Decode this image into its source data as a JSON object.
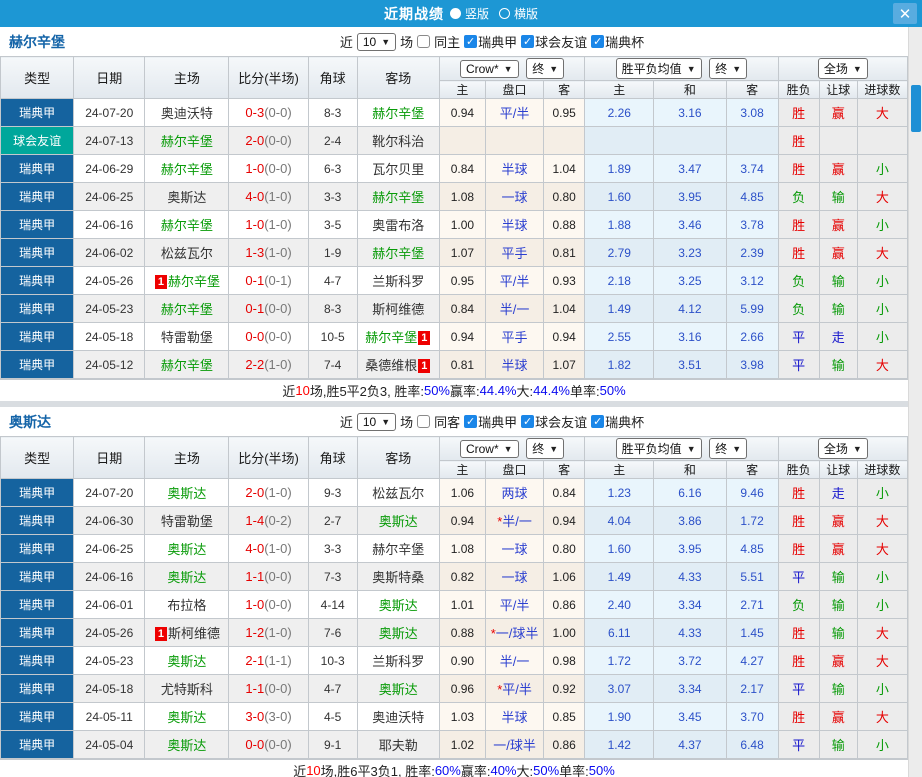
{
  "titlebar": {
    "title": "近期战绩",
    "radio_vertical": "竖版",
    "radio_horizontal": "横版",
    "close": "✕"
  },
  "accent_colors": {
    "titlebar_blue": "#1d97d4",
    "league_blue": "#15639f",
    "friendly_teal": "#00a79b",
    "win_red": "#e60000",
    "lose_green": "#089b08",
    "draw_blue": "#1414cc"
  },
  "filter": {
    "near": "近",
    "count": "10",
    "games": "场"
  },
  "table_header": {
    "type": "类型",
    "date": "日期",
    "home": "主场",
    "score": "比分(半场)",
    "corner": "角球",
    "away": "客场",
    "dd_crow": "Crow*",
    "dd_final1": "终",
    "dd_mean": "胜平负均值",
    "dd_final2": "终",
    "dd_full": "全场",
    "sub_home": "主",
    "sub_handicap": "盘口",
    "sub_away": "客",
    "sub_mwin": "主",
    "sub_mdraw": "和",
    "sub_mlose": "客",
    "res_wdl": "胜负",
    "res_handicap": "让球",
    "res_goals": "进球数"
  },
  "sections": [
    {
      "team": "赫尔辛堡",
      "same_label": "同主",
      "leagues": [
        "瑞典甲",
        "球会友谊",
        "瑞典杯"
      ],
      "rows": [
        {
          "type": "瑞典甲",
          "date": "24-07-20",
          "home": "奥迪沃特",
          "home_focus": false,
          "home_badge": false,
          "score": "0-3",
          "half": "(0-0)",
          "corner": "8-3",
          "away": "赫尔辛堡",
          "away_focus": true,
          "away_badge": false,
          "odds": [
            "0.94",
            "平/半",
            "0.95"
          ],
          "star": false,
          "mean": [
            "2.26",
            "3.16",
            "3.08"
          ],
          "res": [
            "胜",
            "赢",
            "大"
          ]
        },
        {
          "type": "球会友谊",
          "date": "24-07-13",
          "home": "赫尔辛堡",
          "home_focus": true,
          "home_badge": false,
          "score": "2-0",
          "half": "(0-0)",
          "corner": "2-4",
          "away": "靴尔科治",
          "away_focus": false,
          "away_badge": false,
          "odds": [
            "",
            "",
            ""
          ],
          "star": false,
          "mean": [
            "",
            "",
            ""
          ],
          "res": [
            "胜",
            "",
            ""
          ]
        },
        {
          "type": "瑞典甲",
          "date": "24-06-29",
          "home": "赫尔辛堡",
          "home_focus": true,
          "home_badge": false,
          "score": "1-0",
          "half": "(0-0)",
          "corner": "6-3",
          "away": "瓦尔贝里",
          "away_focus": false,
          "away_badge": false,
          "odds": [
            "0.84",
            "半球",
            "1.04"
          ],
          "star": false,
          "mean": [
            "1.89",
            "3.47",
            "3.74"
          ],
          "res": [
            "胜",
            "赢",
            "小"
          ]
        },
        {
          "type": "瑞典甲",
          "date": "24-06-25",
          "home": "奥斯达",
          "home_focus": false,
          "home_badge": false,
          "score": "4-0",
          "half": "(1-0)",
          "corner": "3-3",
          "away": "赫尔辛堡",
          "away_focus": true,
          "away_badge": false,
          "odds": [
            "1.08",
            "一球",
            "0.80"
          ],
          "star": false,
          "mean": [
            "1.60",
            "3.95",
            "4.85"
          ],
          "res": [
            "负",
            "输",
            "大"
          ]
        },
        {
          "type": "瑞典甲",
          "date": "24-06-16",
          "home": "赫尔辛堡",
          "home_focus": true,
          "home_badge": false,
          "score": "1-0",
          "half": "(1-0)",
          "corner": "3-5",
          "away": "奥雷布洛",
          "away_focus": false,
          "away_badge": false,
          "odds": [
            "1.00",
            "半球",
            "0.88"
          ],
          "star": false,
          "mean": [
            "1.88",
            "3.46",
            "3.78"
          ],
          "res": [
            "胜",
            "赢",
            "小"
          ]
        },
        {
          "type": "瑞典甲",
          "date": "24-06-02",
          "home": "松兹瓦尔",
          "home_focus": false,
          "home_badge": false,
          "score": "1-3",
          "half": "(1-0)",
          "corner": "1-9",
          "away": "赫尔辛堡",
          "away_focus": true,
          "away_badge": false,
          "odds": [
            "1.07",
            "平手",
            "0.81"
          ],
          "star": false,
          "mean": [
            "2.79",
            "3.23",
            "2.39"
          ],
          "res": [
            "胜",
            "赢",
            "大"
          ]
        },
        {
          "type": "瑞典甲",
          "date": "24-05-26",
          "home": "赫尔辛堡",
          "home_focus": true,
          "home_badge": true,
          "score": "0-1",
          "half": "(0-1)",
          "corner": "4-7",
          "away": "兰斯科罗",
          "away_focus": false,
          "away_badge": false,
          "odds": [
            "0.95",
            "平/半",
            "0.93"
          ],
          "star": false,
          "mean": [
            "2.18",
            "3.25",
            "3.12"
          ],
          "res": [
            "负",
            "输",
            "小"
          ]
        },
        {
          "type": "瑞典甲",
          "date": "24-05-23",
          "home": "赫尔辛堡",
          "home_focus": true,
          "home_badge": false,
          "score": "0-1",
          "half": "(0-0)",
          "corner": "8-3",
          "away": "斯柯维德",
          "away_focus": false,
          "away_badge": false,
          "odds": [
            "0.84",
            "半/一",
            "1.04"
          ],
          "star": false,
          "mean": [
            "1.49",
            "4.12",
            "5.99"
          ],
          "res": [
            "负",
            "输",
            "小"
          ]
        },
        {
          "type": "瑞典甲",
          "date": "24-05-18",
          "home": "特雷勒堡",
          "home_focus": false,
          "home_badge": false,
          "score": "0-0",
          "half": "(0-0)",
          "corner": "10-5",
          "away": "赫尔辛堡",
          "away_focus": true,
          "away_badge": true,
          "odds": [
            "0.94",
            "平手",
            "0.94"
          ],
          "star": false,
          "mean": [
            "2.55",
            "3.16",
            "2.66"
          ],
          "res": [
            "平",
            "走",
            "小"
          ]
        },
        {
          "type": "瑞典甲",
          "date": "24-05-12",
          "home": "赫尔辛堡",
          "home_focus": true,
          "home_badge": false,
          "score": "2-2",
          "half": "(1-0)",
          "corner": "7-4",
          "away": "桑德维根",
          "away_focus": false,
          "away_badge": true,
          "odds": [
            "0.81",
            "半球",
            "1.07"
          ],
          "star": false,
          "mean": [
            "1.82",
            "3.51",
            "3.98"
          ],
          "res": [
            "平",
            "输",
            "大"
          ]
        }
      ],
      "summary": [
        {
          "t": "近",
          "c": "k"
        },
        {
          "t": "10",
          "c": "r"
        },
        {
          "t": "场,胜5平2负3, 胜率:",
          "c": "k"
        },
        {
          "t": "50%",
          "c": "b"
        },
        {
          "t": " 赢率:",
          "c": "k"
        },
        {
          "t": "44.4%",
          "c": "b"
        },
        {
          "t": " 大:",
          "c": "k"
        },
        {
          "t": "44.4%",
          "c": "b"
        },
        {
          "t": " 单率:",
          "c": "k"
        },
        {
          "t": "50%",
          "c": "b"
        }
      ]
    },
    {
      "team": "奥斯达",
      "same_label": "同客",
      "leagues": [
        "瑞典甲",
        "球会友谊",
        "瑞典杯"
      ],
      "rows": [
        {
          "type": "瑞典甲",
          "date": "24-07-20",
          "home": "奥斯达",
          "home_focus": true,
          "home_badge": false,
          "score": "2-0",
          "half": "(1-0)",
          "corner": "9-3",
          "away": "松兹瓦尔",
          "away_focus": false,
          "away_badge": false,
          "odds": [
            "1.06",
            "两球",
            "0.84"
          ],
          "star": false,
          "mean": [
            "1.23",
            "6.16",
            "9.46"
          ],
          "res": [
            "胜",
            "走",
            "小"
          ]
        },
        {
          "type": "瑞典甲",
          "date": "24-06-30",
          "home": "特雷勒堡",
          "home_focus": false,
          "home_badge": false,
          "score": "1-4",
          "half": "(0-2)",
          "corner": "2-7",
          "away": "奥斯达",
          "away_focus": true,
          "away_badge": false,
          "odds": [
            "0.94",
            "半/一",
            "0.94"
          ],
          "star": true,
          "mean": [
            "4.04",
            "3.86",
            "1.72"
          ],
          "res": [
            "胜",
            "赢",
            "大"
          ]
        },
        {
          "type": "瑞典甲",
          "date": "24-06-25",
          "home": "奥斯达",
          "home_focus": true,
          "home_badge": false,
          "score": "4-0",
          "half": "(1-0)",
          "corner": "3-3",
          "away": "赫尔辛堡",
          "away_focus": false,
          "away_badge": false,
          "odds": [
            "1.08",
            "一球",
            "0.80"
          ],
          "star": false,
          "mean": [
            "1.60",
            "3.95",
            "4.85"
          ],
          "res": [
            "胜",
            "赢",
            "大"
          ]
        },
        {
          "type": "瑞典甲",
          "date": "24-06-16",
          "home": "奥斯达",
          "home_focus": true,
          "home_badge": false,
          "score": "1-1",
          "half": "(0-0)",
          "corner": "7-3",
          "away": "奥斯特桑",
          "away_focus": false,
          "away_badge": false,
          "odds": [
            "0.82",
            "一球",
            "1.06"
          ],
          "star": false,
          "mean": [
            "1.49",
            "4.33",
            "5.51"
          ],
          "res": [
            "平",
            "输",
            "小"
          ]
        },
        {
          "type": "瑞典甲",
          "date": "24-06-01",
          "home": "布拉格",
          "home_focus": false,
          "home_badge": false,
          "score": "1-0",
          "half": "(0-0)",
          "corner": "4-14",
          "away": "奥斯达",
          "away_focus": true,
          "away_badge": false,
          "odds": [
            "1.01",
            "平/半",
            "0.86"
          ],
          "star": false,
          "mean": [
            "2.40",
            "3.34",
            "2.71"
          ],
          "res": [
            "负",
            "输",
            "小"
          ]
        },
        {
          "type": "瑞典甲",
          "date": "24-05-26",
          "home": "斯柯维德",
          "home_focus": false,
          "home_badge": true,
          "score": "1-2",
          "half": "(1-0)",
          "corner": "7-6",
          "away": "奥斯达",
          "away_focus": true,
          "away_badge": false,
          "odds": [
            "0.88",
            "一/球半",
            "1.00"
          ],
          "star": true,
          "mean": [
            "6.11",
            "4.33",
            "1.45"
          ],
          "res": [
            "胜",
            "输",
            "大"
          ]
        },
        {
          "type": "瑞典甲",
          "date": "24-05-23",
          "home": "奥斯达",
          "home_focus": true,
          "home_badge": false,
          "score": "2-1",
          "half": "(1-1)",
          "corner": "10-3",
          "away": "兰斯科罗",
          "away_focus": false,
          "away_badge": false,
          "odds": [
            "0.90",
            "半/一",
            "0.98"
          ],
          "star": false,
          "mean": [
            "1.72",
            "3.72",
            "4.27"
          ],
          "res": [
            "胜",
            "赢",
            "大"
          ]
        },
        {
          "type": "瑞典甲",
          "date": "24-05-18",
          "home": "尤特斯科",
          "home_focus": false,
          "home_badge": false,
          "score": "1-1",
          "half": "(0-0)",
          "corner": "4-7",
          "away": "奥斯达",
          "away_focus": true,
          "away_badge": false,
          "odds": [
            "0.96",
            "平/半",
            "0.92"
          ],
          "star": true,
          "mean": [
            "3.07",
            "3.34",
            "2.17"
          ],
          "res": [
            "平",
            "输",
            "小"
          ]
        },
        {
          "type": "瑞典甲",
          "date": "24-05-11",
          "home": "奥斯达",
          "home_focus": true,
          "home_badge": false,
          "score": "3-0",
          "half": "(3-0)",
          "corner": "4-5",
          "away": "奥迪沃特",
          "away_focus": false,
          "away_badge": false,
          "odds": [
            "1.03",
            "半球",
            "0.85"
          ],
          "star": false,
          "mean": [
            "1.90",
            "3.45",
            "3.70"
          ],
          "res": [
            "胜",
            "赢",
            "大"
          ]
        },
        {
          "type": "瑞典甲",
          "date": "24-05-04",
          "home": "奥斯达",
          "home_focus": true,
          "home_badge": false,
          "score": "0-0",
          "half": "(0-0)",
          "corner": "9-1",
          "away": "耶夫勒",
          "away_focus": false,
          "away_badge": false,
          "odds": [
            "1.02",
            "一/球半",
            "0.86"
          ],
          "star": false,
          "mean": [
            "1.42",
            "4.37",
            "6.48"
          ],
          "res": [
            "平",
            "输",
            "小"
          ]
        }
      ],
      "summary": [
        {
          "t": "近",
          "c": "k"
        },
        {
          "t": "10",
          "c": "r"
        },
        {
          "t": "场,胜6平3负1, 胜率:",
          "c": "k"
        },
        {
          "t": "60%",
          "c": "b"
        },
        {
          "t": " 赢率:",
          "c": "k"
        },
        {
          "t": "40%",
          "c": "b"
        },
        {
          "t": " 大:",
          "c": "k"
        },
        {
          "t": "50%",
          "c": "b"
        },
        {
          "t": " 单率:",
          "c": "k"
        },
        {
          "t": "50%",
          "c": "b"
        }
      ]
    }
  ]
}
